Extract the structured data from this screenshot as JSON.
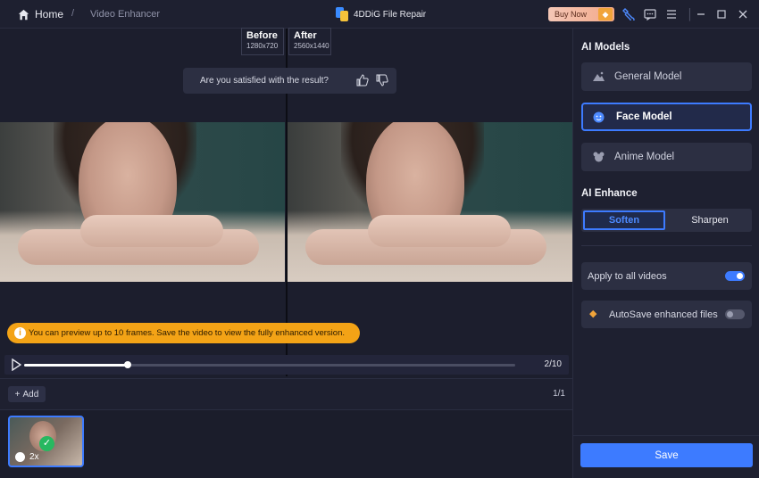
{
  "titlebar": {
    "home_label": "Home",
    "separator": "/",
    "breadcrumb": "Video Enhancer",
    "app_title": "4DDiG File Repair",
    "buy_now": "Buy Now",
    "icons": [
      "tools-icon",
      "feedback-icon",
      "menu-icon",
      "minimize-icon",
      "maximize-icon",
      "close-icon"
    ]
  },
  "compare": {
    "before_label": "Before",
    "before_res": "1280x720",
    "after_label": "After",
    "after_res": "2560x1440"
  },
  "feedback": {
    "question": "Are you satisfied with the result?"
  },
  "notice": {
    "text": "You can preview up to 10 frames. Save the video to view the fully enhanced version."
  },
  "player": {
    "progress": 0.21,
    "frame_count": "2/10"
  },
  "list": {
    "add_label": "Add",
    "page_count": "1/1",
    "thumb_badge": "2x"
  },
  "side": {
    "ai_models_title": "AI Models",
    "models": [
      {
        "label": "General Model",
        "active": false
      },
      {
        "label": "Face Model",
        "active": true
      },
      {
        "label": "Anime Model",
        "active": false
      }
    ],
    "ai_enhance_title": "AI Enhance",
    "enhance_options": [
      "Soften",
      "Sharpen"
    ],
    "apply_all_label": "Apply to all videos",
    "apply_all_on": true,
    "autosave_label": "AutoSave enhanced files",
    "autosave_on": false,
    "save_label": "Save"
  },
  "colors": {
    "accent": "#3d7bff",
    "notice": "#f3a316",
    "success": "#27b860"
  }
}
